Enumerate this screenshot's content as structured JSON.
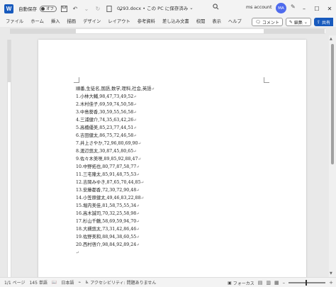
{
  "titlebar": {
    "autosave_label": "自動保存",
    "autosave_state": "オフ",
    "doc_title": "0293.docx • この PC に保存済み",
    "account": "ms account",
    "avatar_initials": "MA"
  },
  "menu": {
    "items": [
      "ファイル",
      "ホーム",
      "挿入",
      "描画",
      "デザイン",
      "レイアウト",
      "参考資料",
      "差し込み文書",
      "校閲",
      "表示",
      "ヘルプ"
    ],
    "comment_label": "コメント",
    "edit_label": "編集",
    "share_label": "共有"
  },
  "document": {
    "lines": [
      "順番,生徒名,国語,数学,理科,社会,英語",
      "1.小林大輔,98,47,73,49,52",
      "2.木村佳子,69,59,74,50,58",
      "3.中島葵香,30,59,55,56,58",
      "4.三浦健介,74,35,63,42,26",
      "5.高橋優美,85,23,77,44,51",
      "6.吉田健太,86,75,72,46,58",
      "7.井上さやか,72,96,80,69,90",
      "8.渡辺悠太,30,87,45,80,65",
      "9.佐々木美咲,89,85,92,88,47",
      "10.中野拓也,80,77,87,58,77",
      "11.三宅隆太,85,91,48,75,53",
      "12.吉岡みゆき,87,65,70,44,85",
      "13.安藤都香,72,30,72,90,48",
      "14.小笠原健太,49,46,83,22,88",
      "15.堀内美佳,81,58,75,55,34",
      "16.高木誠司,70,32,25,58,98",
      "17.杉山千鶴,58,69,59,94,70",
      "18.大槻悠太,73,31,42,86,46",
      "19.佐野美和,88,94,38,60,55",
      "20.西村啓介,98,84,92,89,24"
    ]
  },
  "status": {
    "page": "1/1 ページ",
    "words": "145 単語",
    "language": "日本語",
    "accessibility": "アクセシビリティ: 問題ありません",
    "focus": "フォーカス"
  },
  "colors": {
    "accent": "#185abd",
    "avatar": "#4f6bed"
  },
  "icons": {
    "app": "word-logo-icon",
    "save": "save-icon",
    "undo": "undo-icon",
    "redo": "redo-icon",
    "search": "search-icon",
    "pen": "pen-icon",
    "comment": "comment-icon",
    "edit": "pencil-icon",
    "share": "share-icon"
  }
}
